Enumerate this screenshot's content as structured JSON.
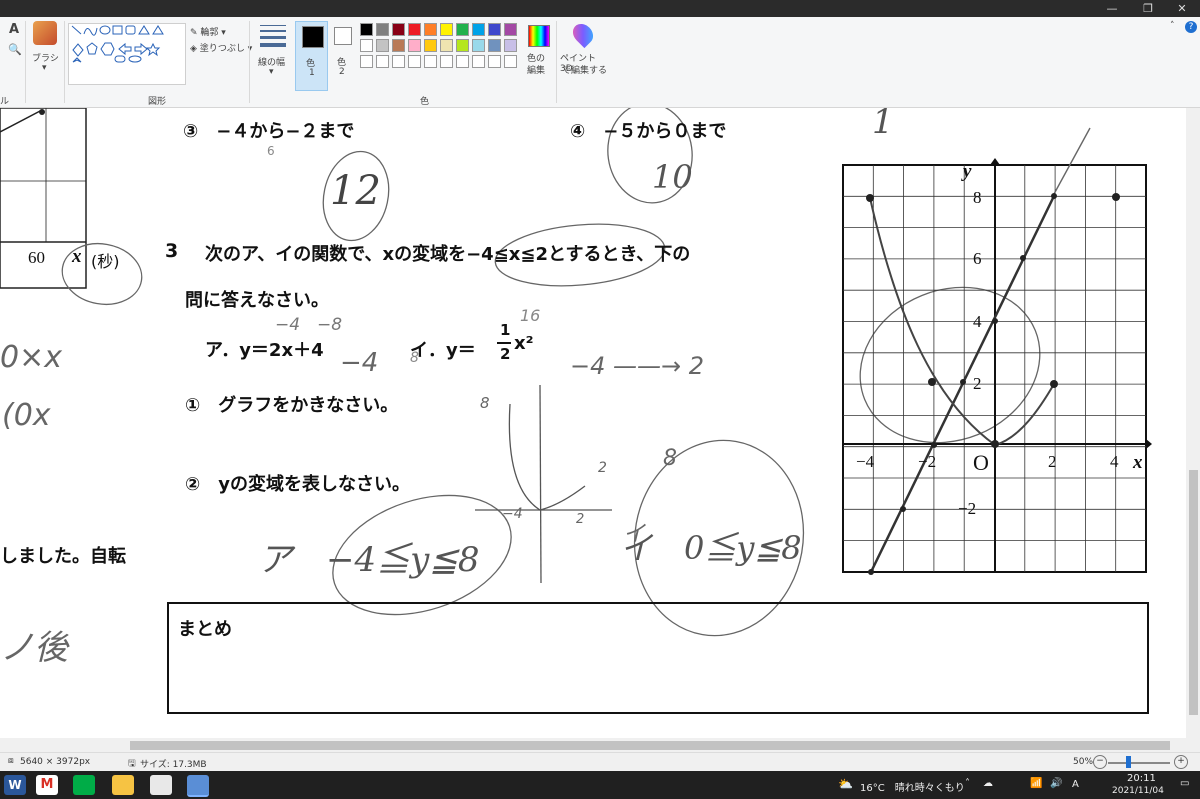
{
  "ribbon": {
    "brush_label": "ブラシ",
    "shapes_label": "図形",
    "outline_label": "輪郭",
    "fill_label": "塗りつぶし",
    "size_label": "線の幅",
    "color1_label": "色",
    "color1_num": "1",
    "color2_label": "色",
    "color2_num": "2",
    "colors_group_label": "色",
    "edit_colors_label1": "色の",
    "edit_colors_label2": "編集",
    "paint3d_label1": "ペイント 3D",
    "paint3d_label2": "で編集する",
    "tool_a": "A",
    "tool_left_edge": "ル",
    "palette": [
      "#000000",
      "#7f7f7f",
      "#880015",
      "#ed1c24",
      "#ff7f27",
      "#fff200",
      "#22b14c",
      "#00a2e8",
      "#3f48cc",
      "#a349a4",
      "#ffffff",
      "#c3c3c3",
      "#b97a57",
      "#ffaec9",
      "#ffc90e",
      "#efe4b0",
      "#b5e61d",
      "#99d9ea",
      "#7092be",
      "#c8bfe7"
    ]
  },
  "doc": {
    "q3": "③　−４から−２まで",
    "q4": "④　−５から０まで",
    "hand_12": "12",
    "hand_10": "10",
    "hand_1": "1",
    "hand_6": "6",
    "axis60": "60",
    "axis_x": "x",
    "sec": "(秒)",
    "problem_num": "3",
    "p_line1": "次のア、イの関数で、xの変域を−4≦x≦2とするとき、下の",
    "p_line2": "問に答えなさい。",
    "func_a": "ア．y＝2x＋4",
    "func_i_prefix": "イ．y＝",
    "func_i_frac_n": "1",
    "func_i_frac_d": "2",
    "func_i_suffix": "x²",
    "sub1": "①　グラフをかきなさい。",
    "sub2": "②　yの変域を表しなさい。",
    "note_a": "ア　−4≦y≦8",
    "note_i": "イ　0≦y≦8",
    "hand_range": "−4 ——→ 2",
    "hand_m48": "−4　−8",
    "hand_m4": "−4",
    "hand_8a": "8",
    "hand_16": "16",
    "hand_8b": "8",
    "hand_2a": "2",
    "hand_m4b": "−4",
    "hand_2b": "2",
    "hand_i": "イ",
    "hand_8c": "8",
    "left_frag1": "しました。自転",
    "left_frag2": "ノ後",
    "left_frag3": "0×x",
    "left_frag4": "(0x",
    "matome": "まとめ",
    "graph_y": "y",
    "graph_x": "x",
    "graph_o": "O",
    "graph_y8": "8",
    "graph_y6": "6",
    "graph_y4": "4",
    "graph_y2": "2",
    "graph_ym2": "−2",
    "graph_xm4": "−4",
    "graph_xm2": "−2",
    "graph_x2": "2",
    "graph_x4": "4"
  },
  "status": {
    "dimensions": "5640 × 3972px",
    "size": "サイズ: 17.3MB",
    "zoom": "50%"
  },
  "taskbar": {
    "weather": "16°C　晴れ時々くもり",
    "time": "20:11",
    "date": "2021/11/04",
    "ime": "A"
  }
}
